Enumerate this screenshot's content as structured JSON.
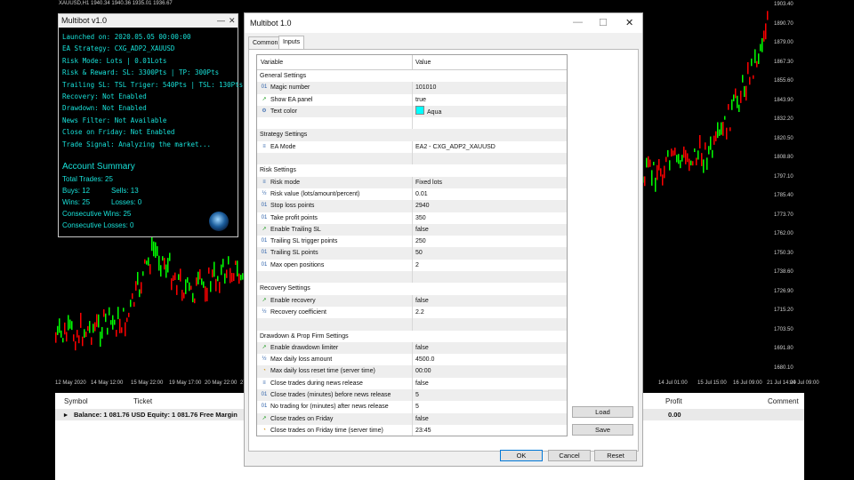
{
  "chart": {
    "header": "XAUUSD,H1  1940.34 1940.36 1935.01 1936.67",
    "price_labels": [
      "1903.40",
      "1890.70",
      "1879.00",
      "1867.30",
      "1855.60",
      "1843.90",
      "1832.20",
      "1820.50",
      "1808.80",
      "1797.10",
      "1785.40",
      "1773.70",
      "1762.00",
      "1750.30",
      "1738.60",
      "1726.90",
      "1715.20",
      "1703.50",
      "1691.80",
      "1680.10"
    ],
    "time_labels": [
      "12 May 2020",
      "14 May 12:00",
      "15 May 22:00",
      "19 May 17:00",
      "20 May 22:00",
      "27 May 11:00",
      "14 Jul 01:00",
      "15 Jul 15:00",
      "16 Jul 09:00",
      "21 Jul 14:00",
      "24 Jul 09:00"
    ],
    "colors": {
      "up": "#00ff00",
      "down": "#ff0000",
      "background": "#000000"
    }
  },
  "panel": {
    "title": "Multibot v1.0",
    "lines": [
      "Launched on: 2020.05.05 00:00:00",
      "EA Strategy: CXG_ADP2_XAUUSD",
      "Risk Mode: Lots | 0.01Lots",
      "Risk & Reward: SL: 3300Pts | TP: 300Pts",
      "Trailing SL: TSL Triger: 540Pts | TSL: 130Pts",
      "Recovery: Not Enabled",
      "Drawdown: Not Enabled",
      "News Filter: Not Available",
      "Close on Friday: Not Enabled",
      "Trade Signal: Analyzing the market..."
    ],
    "account_title": "Account Summary",
    "total_trades": "Total Trades: 25",
    "buys": "Buys: 12",
    "sells": "Sells: 13",
    "wins": "Wins: 25",
    "losses": "Losses: 0",
    "consecutive_wins": "Consecutive Wins: 25",
    "consecutive_losses": "Consecutive Losses: 0",
    "text_color": "#18e0d8"
  },
  "terminal": {
    "headers": {
      "symbol": "Symbol",
      "ticket": "Ticket",
      "profit": "Profit",
      "comment": "Comment"
    },
    "balance_row": "Balance: 1 081.76 USD  Equity: 1 081.76  Free Margin",
    "profit_value": "0.00"
  },
  "dialog": {
    "title": "Multibot 1.0",
    "tabs": [
      "Common",
      "Inputs"
    ],
    "active_tab": "Inputs",
    "col_variable": "Variable",
    "col_value": "Value",
    "rows": [
      {
        "type": "section",
        "name": "General Settings"
      },
      {
        "type": "item",
        "icon": "01",
        "name": "Magic number",
        "value": "101010"
      },
      {
        "type": "item",
        "icon": "arrow",
        "name": "Show EA panel",
        "value": "true"
      },
      {
        "type": "item",
        "icon": "palette",
        "name": "Text color",
        "value": "Aqua",
        "swatch": "#00ffff"
      },
      {
        "type": "blank"
      },
      {
        "type": "section",
        "name": "Strategy Settings"
      },
      {
        "type": "item",
        "icon": "enum",
        "name": "EA Mode",
        "value": "EA2 - CXG_ADP2_XAUUSD"
      },
      {
        "type": "blank"
      },
      {
        "type": "section",
        "name": "Risk Settings"
      },
      {
        "type": "item",
        "icon": "enum",
        "name": "Risk mode",
        "value": "Fixed lots"
      },
      {
        "type": "item",
        "icon": "half",
        "name": "Risk value (lots/amount/percent)",
        "value": "0.01"
      },
      {
        "type": "item",
        "icon": "01",
        "name": "Stop loss points",
        "value": "2940"
      },
      {
        "type": "item",
        "icon": "01",
        "name": "Take profit points",
        "value": "350"
      },
      {
        "type": "item",
        "icon": "arrow",
        "name": "Enable Trailing SL",
        "value": "false"
      },
      {
        "type": "item",
        "icon": "01",
        "name": "Trailing SL trigger points",
        "value": "250"
      },
      {
        "type": "item",
        "icon": "01",
        "name": "Trailing SL points",
        "value": "50"
      },
      {
        "type": "item",
        "icon": "01",
        "name": "Max open positions",
        "value": "2"
      },
      {
        "type": "blank"
      },
      {
        "type": "section",
        "name": "Recovery Settings"
      },
      {
        "type": "item",
        "icon": "arrow",
        "name": "Enable recovery",
        "value": "false"
      },
      {
        "type": "item",
        "icon": "half",
        "name": "Recovery coefficient",
        "value": "2.2"
      },
      {
        "type": "blank"
      },
      {
        "type": "section",
        "name": "Drawdown & Prop Firm Settings"
      },
      {
        "type": "item",
        "icon": "arrow",
        "name": "Enable drawdown limiter",
        "value": "false"
      },
      {
        "type": "item",
        "icon": "half",
        "name": "Max daily loss amount",
        "value": "4500.0"
      },
      {
        "type": "item",
        "icon": "time",
        "name": "Max daily loss reset time (server time)",
        "value": "00:00"
      },
      {
        "type": "item",
        "icon": "enum",
        "name": "Close trades during news release",
        "value": "false"
      },
      {
        "type": "item",
        "icon": "01",
        "name": "Close trades (minutes) before news release",
        "value": "5"
      },
      {
        "type": "item",
        "icon": "01",
        "name": "No trading for (minutes) after news release",
        "value": "5"
      },
      {
        "type": "item",
        "icon": "arrow",
        "name": "Close trades on Friday",
        "value": "false"
      },
      {
        "type": "item",
        "icon": "time",
        "name": "Close trades on Friday time (server time)",
        "value": "23:45"
      }
    ],
    "buttons": {
      "load": "Load",
      "save": "Save",
      "ok": "OK",
      "cancel": "Cancel",
      "reset": "Reset"
    }
  }
}
